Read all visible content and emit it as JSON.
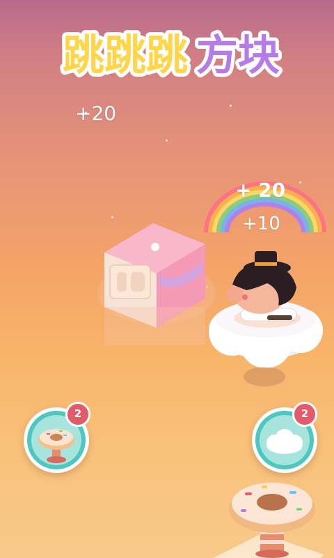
{
  "title": {
    "part1": "跳跳跳",
    "part2": "方块"
  },
  "scores": {
    "left": "+20",
    "rainbow": "+ 20",
    "below": "+10"
  },
  "items": [
    {
      "name": "donut",
      "count": "2"
    },
    {
      "name": "cloud",
      "count": "2"
    }
  ],
  "colors": {
    "title_yellow": "#ffd54a",
    "title_purple": "#b57be8",
    "button_teal": "#4fc7c1",
    "badge_red": "#e35b69",
    "cake_pink": "#f59ab6"
  }
}
